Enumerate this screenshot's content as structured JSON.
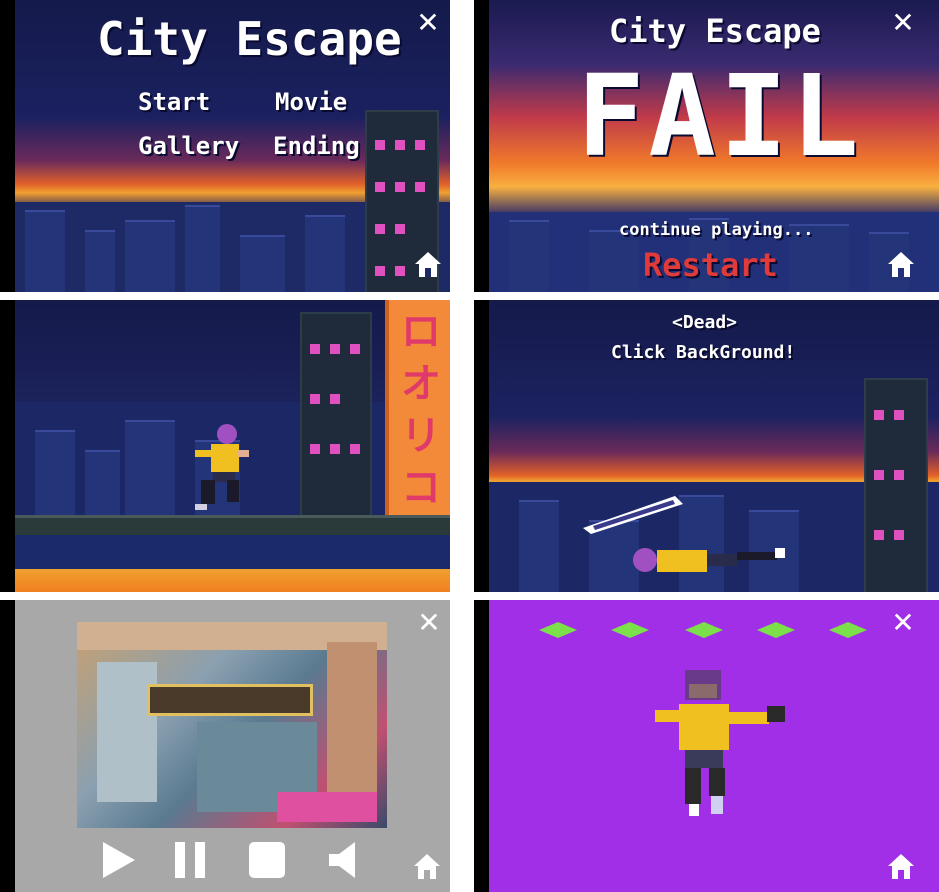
{
  "panels": {
    "title_screen": {
      "title": "City Escape",
      "menu": [
        "Start",
        "Movie",
        "Gallery",
        "Ending"
      ],
      "close_icon": "close-icon",
      "home_icon": "home-icon"
    },
    "fail_screen": {
      "title": "City Escape",
      "big_text": "FAIL",
      "subtitle": "continue playing...",
      "restart_label": "Restart",
      "restart_color": "#e03a3a"
    },
    "gameplay_screen": {
      "sign_text": "ロオリコ"
    },
    "dead_screen": {
      "line1": "<Dead>",
      "line2": "Click BackGround!"
    },
    "movie_screen": {
      "background_color": "#a8a8a8",
      "controls": [
        "play-icon",
        "pause-icon",
        "stop-icon",
        "volume-icon"
      ]
    },
    "gallery_screen": {
      "background_color": "#a22fe8",
      "diamond_color": "#7be04a",
      "diamond_count": 5
    }
  }
}
